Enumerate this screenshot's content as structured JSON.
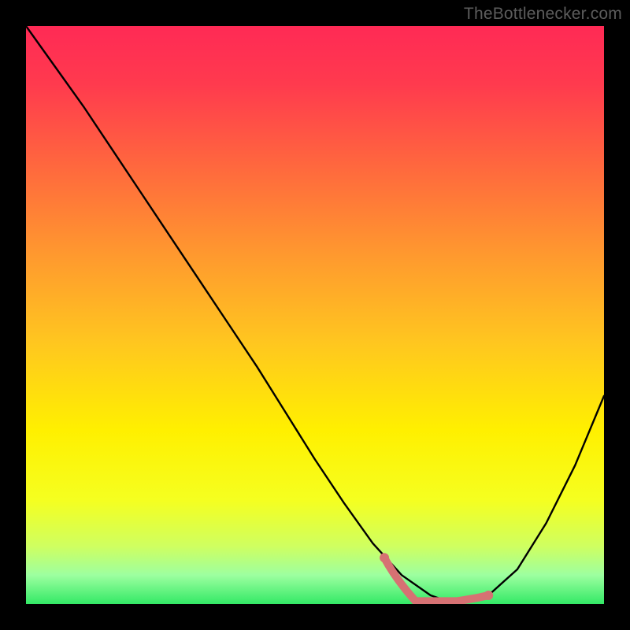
{
  "watermark": "TheBottlenecker.com",
  "chart_data": {
    "type": "line",
    "title": "",
    "xlabel": "",
    "ylabel": "",
    "xlim": [
      0,
      100
    ],
    "ylim": [
      0,
      100
    ],
    "series": [
      {
        "name": "curve",
        "x": [
          0,
          5,
          10,
          15,
          20,
          25,
          30,
          35,
          40,
          45,
          50,
          55,
          60,
          65,
          70,
          72,
          74,
          76,
          78,
          80,
          85,
          90,
          95,
          100
        ],
        "y": [
          100,
          93,
          86,
          78.5,
          71,
          63.5,
          56,
          48.5,
          41,
          33,
          25,
          17.5,
          10.5,
          5,
          1.5,
          0.8,
          0.5,
          0.5,
          0.8,
          1.5,
          6,
          14,
          24,
          36
        ]
      }
    ],
    "highlight_segment": {
      "name": "minimum-band",
      "x": [
        62,
        80
      ],
      "y_at_ends": [
        8,
        1.5
      ],
      "flat_y": 0.5
    },
    "gradient_stops": [
      {
        "offset": 0.0,
        "color": "#ff2a55"
      },
      {
        "offset": 0.1,
        "color": "#ff3a4e"
      },
      {
        "offset": 0.25,
        "color": "#ff6a3d"
      },
      {
        "offset": 0.4,
        "color": "#ff9a2e"
      },
      {
        "offset": 0.55,
        "color": "#ffc71f"
      },
      {
        "offset": 0.7,
        "color": "#fff000"
      },
      {
        "offset": 0.82,
        "color": "#f5ff20"
      },
      {
        "offset": 0.9,
        "color": "#cfff60"
      },
      {
        "offset": 0.95,
        "color": "#9dffa0"
      },
      {
        "offset": 1.0,
        "color": "#33e966"
      }
    ],
    "curve_color": "#000000",
    "highlight_color": "#d67173"
  }
}
